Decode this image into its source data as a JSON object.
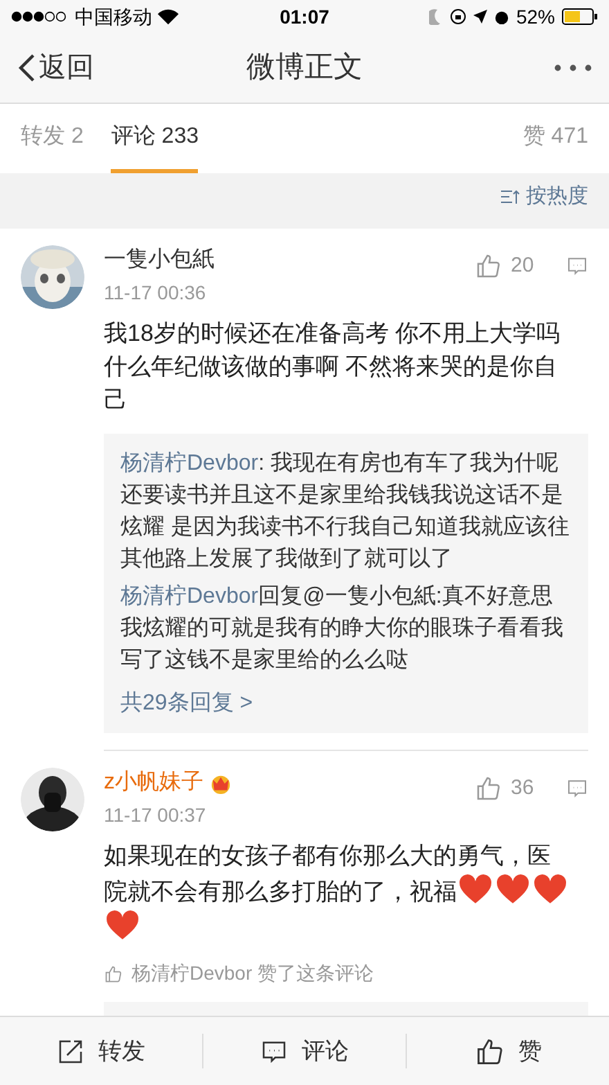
{
  "status_bar": {
    "carrier": "中国移动",
    "time": "01:07",
    "battery": "52%"
  },
  "nav": {
    "back": "返回",
    "title": "微博正文"
  },
  "tabs": [
    {
      "label": "转发 2",
      "selected": false
    },
    {
      "label": "评论 233",
      "selected": true
    }
  ],
  "likes_tab": "赞 471",
  "sort": "按热度",
  "comments": [
    {
      "user": "一隻小包紙",
      "vip": false,
      "time": "11-17 00:36",
      "likes": "20",
      "text": "我18岁的时候还在准备高考 你不用上大学吗什么年纪做该做的事啊 不然将来哭的是你自己",
      "replies": [
        {
          "user": "杨清柠Devbor",
          "text": ": 我现在有房也有车了我为什呢还要读书并且这不是家里给我钱我说这话不是炫耀 是因为我读书不行我自己知道我就应该往其他路上发展了我做到了就可以了"
        },
        {
          "user": "杨清柠Devbor",
          "target": "回复@一隻小包紙",
          "text": ":真不好意思我炫耀的可就是我有的睁大你的眼珠子看看我写了这钱不是家里给的么么哒"
        }
      ],
      "more_replies": "共29条回复 >"
    },
    {
      "user": "z小帆妹子",
      "vip": true,
      "time": "11-17 00:37",
      "likes": "36",
      "text": "如果现在的女孩子都有你那么大的勇气，医院就不会有那么多打胎的了，祝福",
      "emoji": [
        {
          "kind": "heart"
        },
        {
          "kind": "heart"
        },
        {
          "kind": "heart"
        },
        {
          "kind": "heart"
        }
      ],
      "liked_by": "杨清柠Devbor 赞了这条评论"
    }
  ],
  "toolbar": [
    {
      "kind": "repost",
      "label": "转发"
    },
    {
      "kind": "comment",
      "label": "评论"
    },
    {
      "kind": "like",
      "label": "赞"
    }
  ]
}
